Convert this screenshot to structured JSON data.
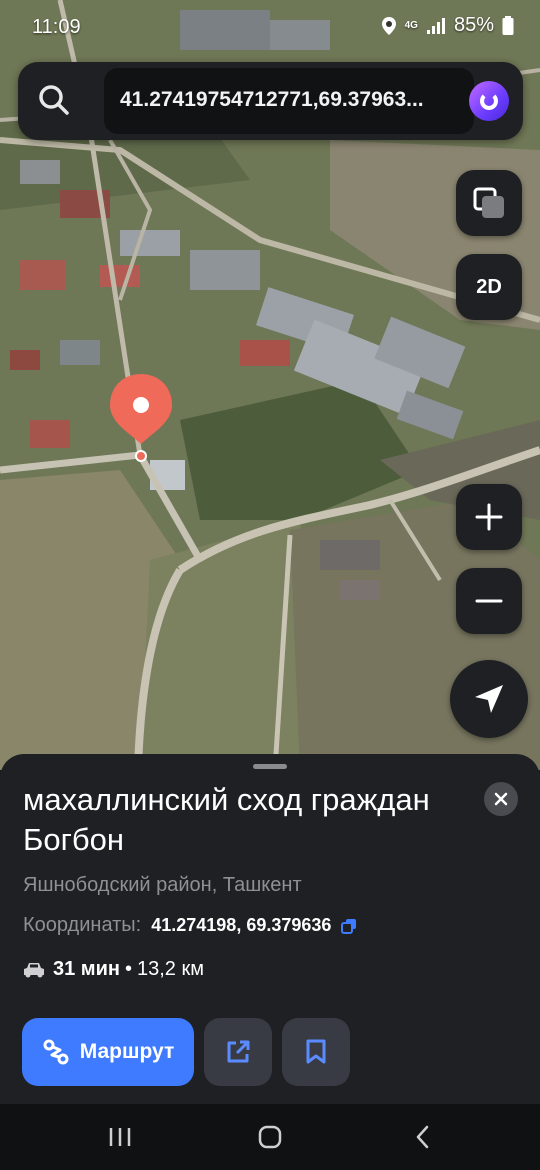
{
  "status_bar": {
    "time": "11:09",
    "network": "4G",
    "battery": "85%"
  },
  "search": {
    "query": "41.27419754712771,69.37963..."
  },
  "map_controls": {
    "mode_label": "2D"
  },
  "place": {
    "title": "махаллинский сход граждан Богбон",
    "subtitle": "Яшнободский район, Ташкент",
    "coords_label": "Координаты:",
    "coords_value": "41.274198, 69.379636",
    "route_time": "31 мин",
    "route_separator": "•",
    "route_distance": "13,2 км",
    "route_button_label": "Маршрут"
  },
  "colors": {
    "accent": "#3f7bff",
    "pin": "#f06a5a",
    "sheet_bg": "#1f2023"
  },
  "icons": [
    "search-icon",
    "alice-icon",
    "layers-icon",
    "plus-icon",
    "minus-icon",
    "locate-icon",
    "close-icon",
    "copy-icon",
    "car-icon",
    "route-icon",
    "share-icon",
    "bookmark-icon",
    "recents-icon",
    "home-icon",
    "back-icon"
  ]
}
